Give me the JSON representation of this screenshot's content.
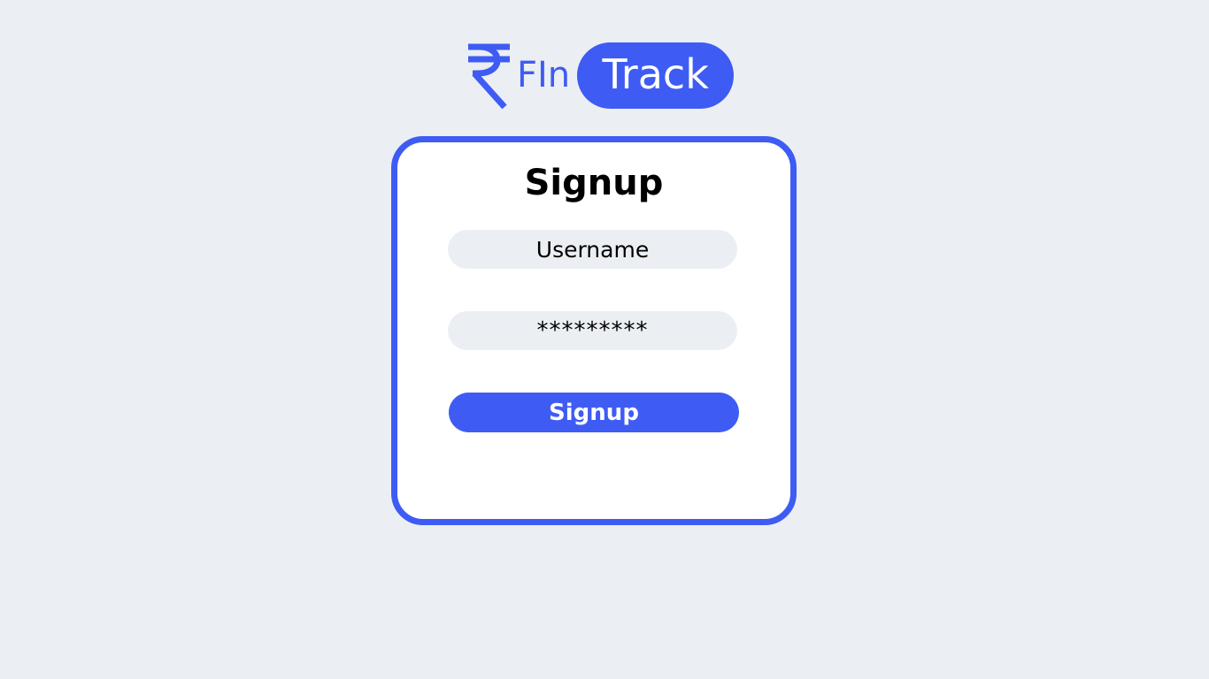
{
  "brand": {
    "icon": "rupee-icon",
    "name_part1": "FIn",
    "name_part2": "Track",
    "accent_color": "#3e5cf3",
    "background_color": "#ebeff3"
  },
  "signup_form": {
    "title": "Signup",
    "username_placeholder": "Username",
    "password_value": "*********",
    "submit_label": "Signup"
  }
}
